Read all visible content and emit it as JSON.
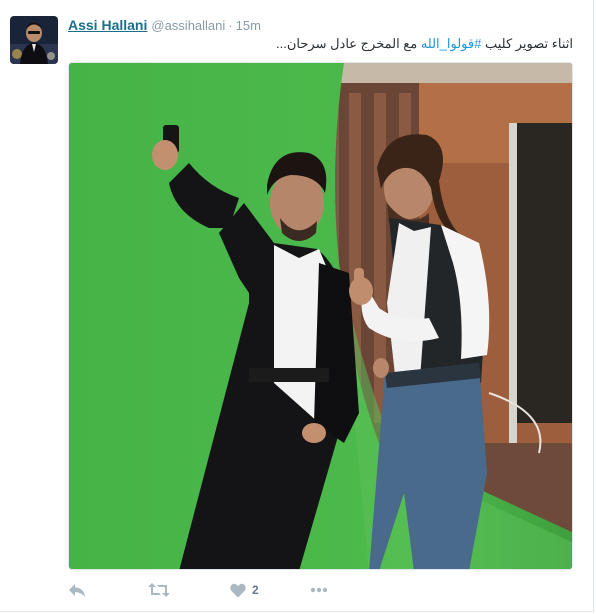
{
  "tweet": {
    "user": {
      "fullname": "Assi Hallani",
      "handle": "@assihallani"
    },
    "separator": "·",
    "time": "15m",
    "text_before": "اثناء تصوير كليب ",
    "hashtag": "#قولوا_الله",
    "text_after": " مع المخرج عادل سرحان..."
  },
  "actions": {
    "like_count": "2"
  },
  "colors": {
    "name_link": "#1b6f8a",
    "hashtag": "#1b95e0",
    "muted": "#8899a6",
    "icons": "#aab8c2"
  },
  "icons": [
    "reply-icon",
    "retweet-icon",
    "like-icon",
    "more-icon"
  ]
}
